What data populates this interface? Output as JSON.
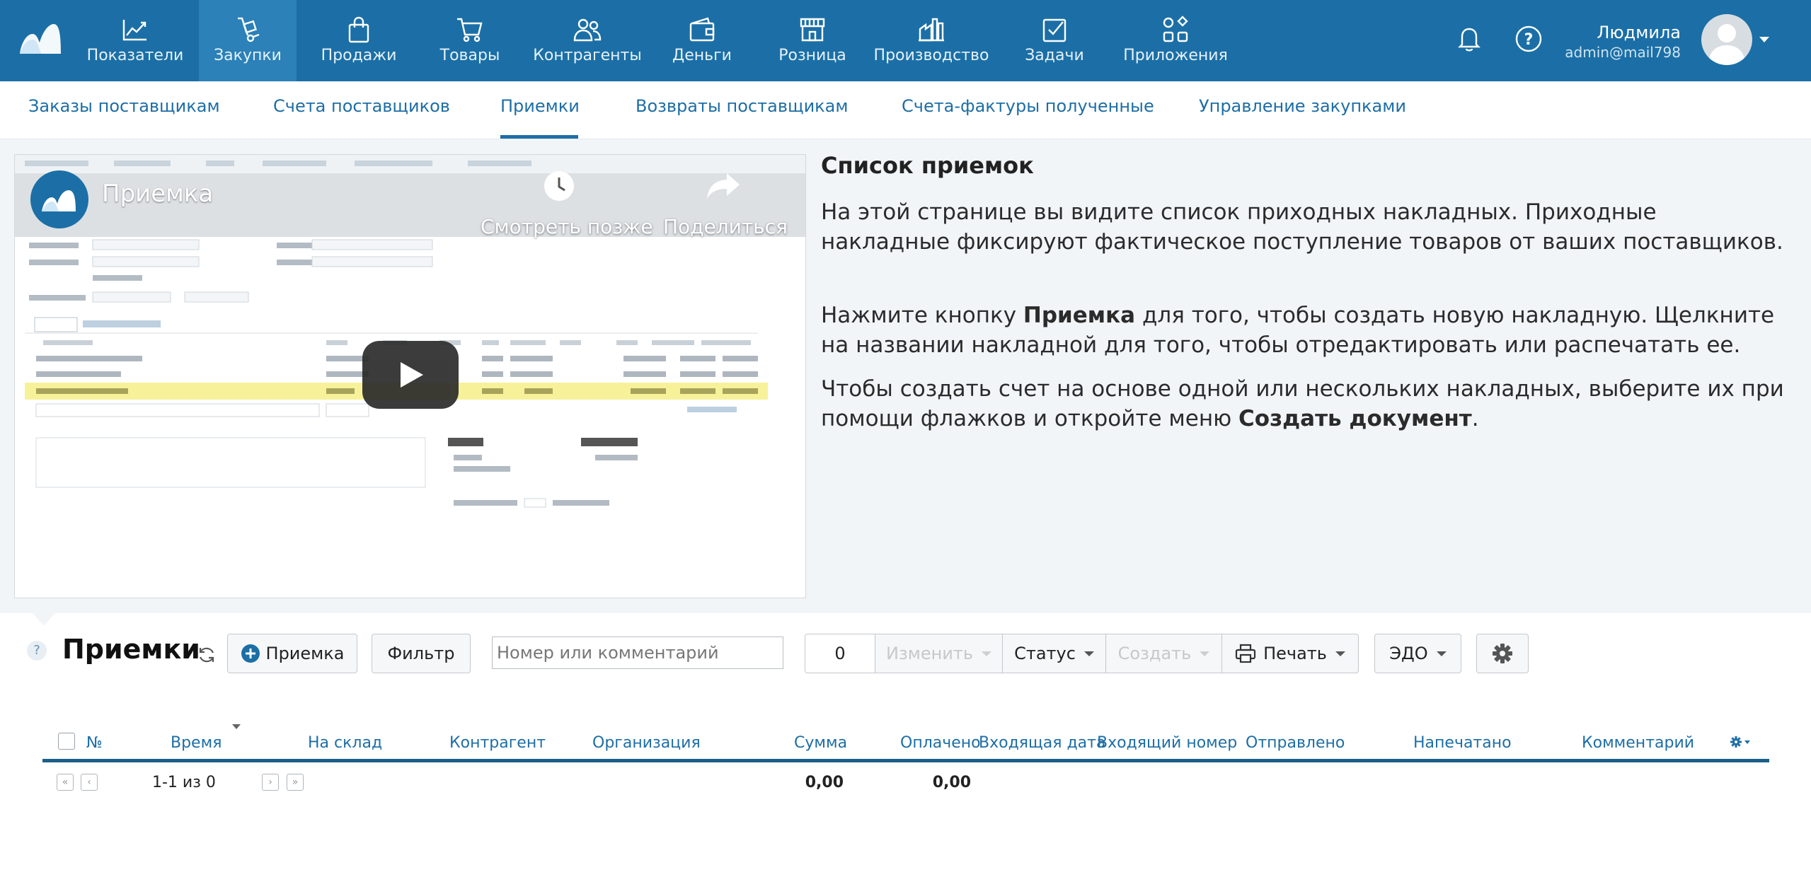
{
  "colors": {
    "topbar": "#1b6fa6",
    "active": "#2b81b8",
    "link": "#1e6ea5",
    "panel": "#f1f5f8"
  },
  "nav": {
    "items": [
      {
        "label": "Показатели",
        "icon": "chart-line-icon"
      },
      {
        "label": "Закупки",
        "icon": "hand-truck-icon",
        "active": true
      },
      {
        "label": "Продажи",
        "icon": "shopping-bag-icon"
      },
      {
        "label": "Товары",
        "icon": "cart-icon"
      },
      {
        "label": "Контрагенты",
        "icon": "people-icon"
      },
      {
        "label": "Деньги",
        "icon": "wallet-icon"
      },
      {
        "label": "Розница",
        "icon": "store-icon"
      },
      {
        "label": "Производство",
        "icon": "factory-icon"
      },
      {
        "label": "Задачи",
        "icon": "checkbox-icon"
      },
      {
        "label": "Приложения",
        "icon": "apps-grid-icon"
      }
    ]
  },
  "user": {
    "name": "Людмила",
    "email": "admin@mail798"
  },
  "subnav": {
    "items": [
      {
        "label": "Заказы поставщикам"
      },
      {
        "label": "Счета поставщиков"
      },
      {
        "label": "Приемки",
        "active": true
      },
      {
        "label": "Возвраты поставщикам"
      },
      {
        "label": "Счета-фактуры полученные"
      },
      {
        "label": "Управление закупками"
      }
    ]
  },
  "video": {
    "title": "Приемка",
    "watch_later": "Смотреть позже",
    "share": "Поделиться"
  },
  "info": {
    "title": "Список приемок",
    "p1": "На этой странице вы видите список приходных накладных. Приходные накладные фиксируют фактическое поступление товаров от ваших поставщиков.",
    "p2_a": "Нажмите кнопку ",
    "p2_b": "Приемка",
    "p2_c": " для того, чтобы создать новую накладную. Щелкните на названии накладной для того, чтобы отредактировать или распечатать ее.",
    "p3_a": "Чтобы создать счет на основе одной или нескольких накладных, выберите их при помощи флажков и откройте меню ",
    "p3_b": "Создать документ",
    "p3_c": "."
  },
  "toolbar": {
    "help": "?",
    "title": "Приемки",
    "add_label": "Приемка",
    "filter_label": "Фильтр",
    "search_placeholder": "Номер или комментарий",
    "selected_count": "0",
    "edit_label": "Изменить",
    "status_label": "Статус",
    "create_label": "Создать",
    "print_label": "Печать",
    "edo_label": "ЭДО"
  },
  "table": {
    "columns": [
      "№",
      "Время",
      "На склад",
      "Контрагент",
      "Организация",
      "Сумма",
      "Оплачено",
      "Входящая дата",
      "Входящий номер",
      "Отправлено",
      "Напечатано",
      "Комментарий"
    ],
    "pager": "1-1 из 0",
    "total_sum": "0,00",
    "total_paid": "0,00"
  }
}
